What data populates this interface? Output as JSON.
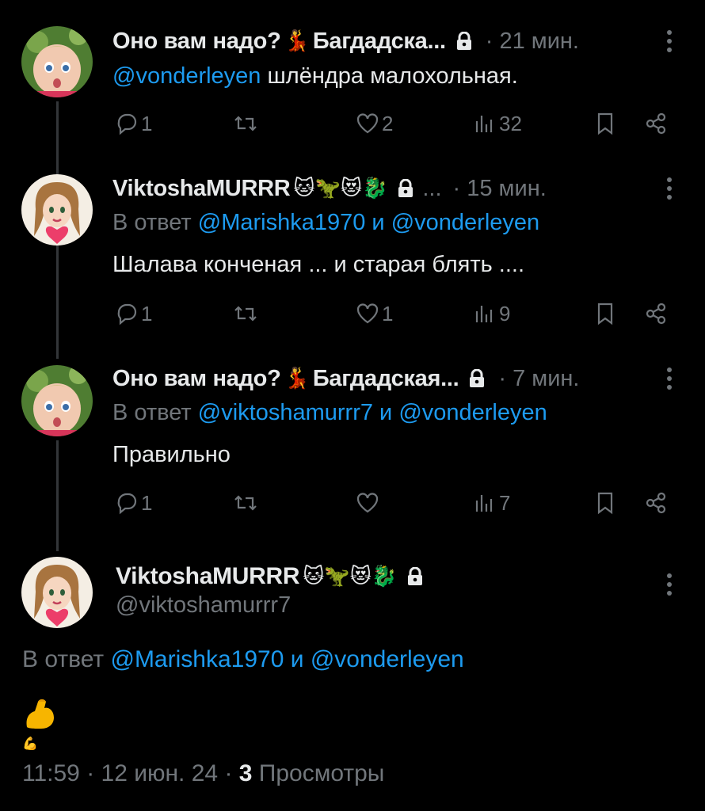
{
  "colors": {
    "background": "#000000",
    "text": "#e7e9ea",
    "muted": "#71767b",
    "link": "#1d9bf0",
    "thread_line": "#333639"
  },
  "tweets": [
    {
      "author": "Оно вам надо?",
      "author_emoji": "💃",
      "author_suffix": "Багдадска...",
      "time": "· 21 мин.",
      "body_mention": "@vonderleyen",
      "body_text": " шлёндра малохольная.",
      "replies": "1",
      "retweets": "",
      "likes": "2",
      "views": "32"
    },
    {
      "author": "ViktoshaMURRR",
      "author_emoji": "🐱🦖😻🐉",
      "ellipsis": "...",
      "time": "· 15 мин.",
      "reply_prefix": "В ответ ",
      "reply_mention_1": "@Marishka1970",
      "reply_and": " и ",
      "reply_mention_2": "@vonderleyen",
      "body_text": "Шалава конченая ... и старая блять ....",
      "replies": "1",
      "retweets": "",
      "likes": "1",
      "views": "9"
    },
    {
      "author": "Оно вам надо?",
      "author_emoji": "💃",
      "author_suffix": "Багдадская...",
      "time": "· 7 мин.",
      "reply_prefix": "В ответ ",
      "reply_mention_1": "@viktoshamurrr7",
      "reply_and": " и ",
      "reply_mention_2": "@vonderleyen",
      "body_text": "Правильно",
      "replies": "1",
      "retweets": "",
      "likes": "",
      "views": "7"
    }
  ],
  "main_tweet": {
    "author": "ViktoshaMURRR",
    "author_emoji": "🐱🦖😻🐉",
    "handle": "@viktoshamurrr7",
    "reply_prefix": "В ответ ",
    "reply_mention_1": "@Marishka1970",
    "reply_and": " и ",
    "reply_mention_2": "@vonderleyen",
    "body_emoji": "💪",
    "time": "11:59",
    "sep1": " · ",
    "date": "12 июн. 24",
    "sep2": " · ",
    "views_count": "3",
    "views_label": " Просмотры"
  },
  "icons": [
    "reply-icon",
    "retweet-icon",
    "like-icon",
    "views-icon",
    "bookmark-icon",
    "share-icon",
    "lock-icon",
    "more-icon"
  ]
}
